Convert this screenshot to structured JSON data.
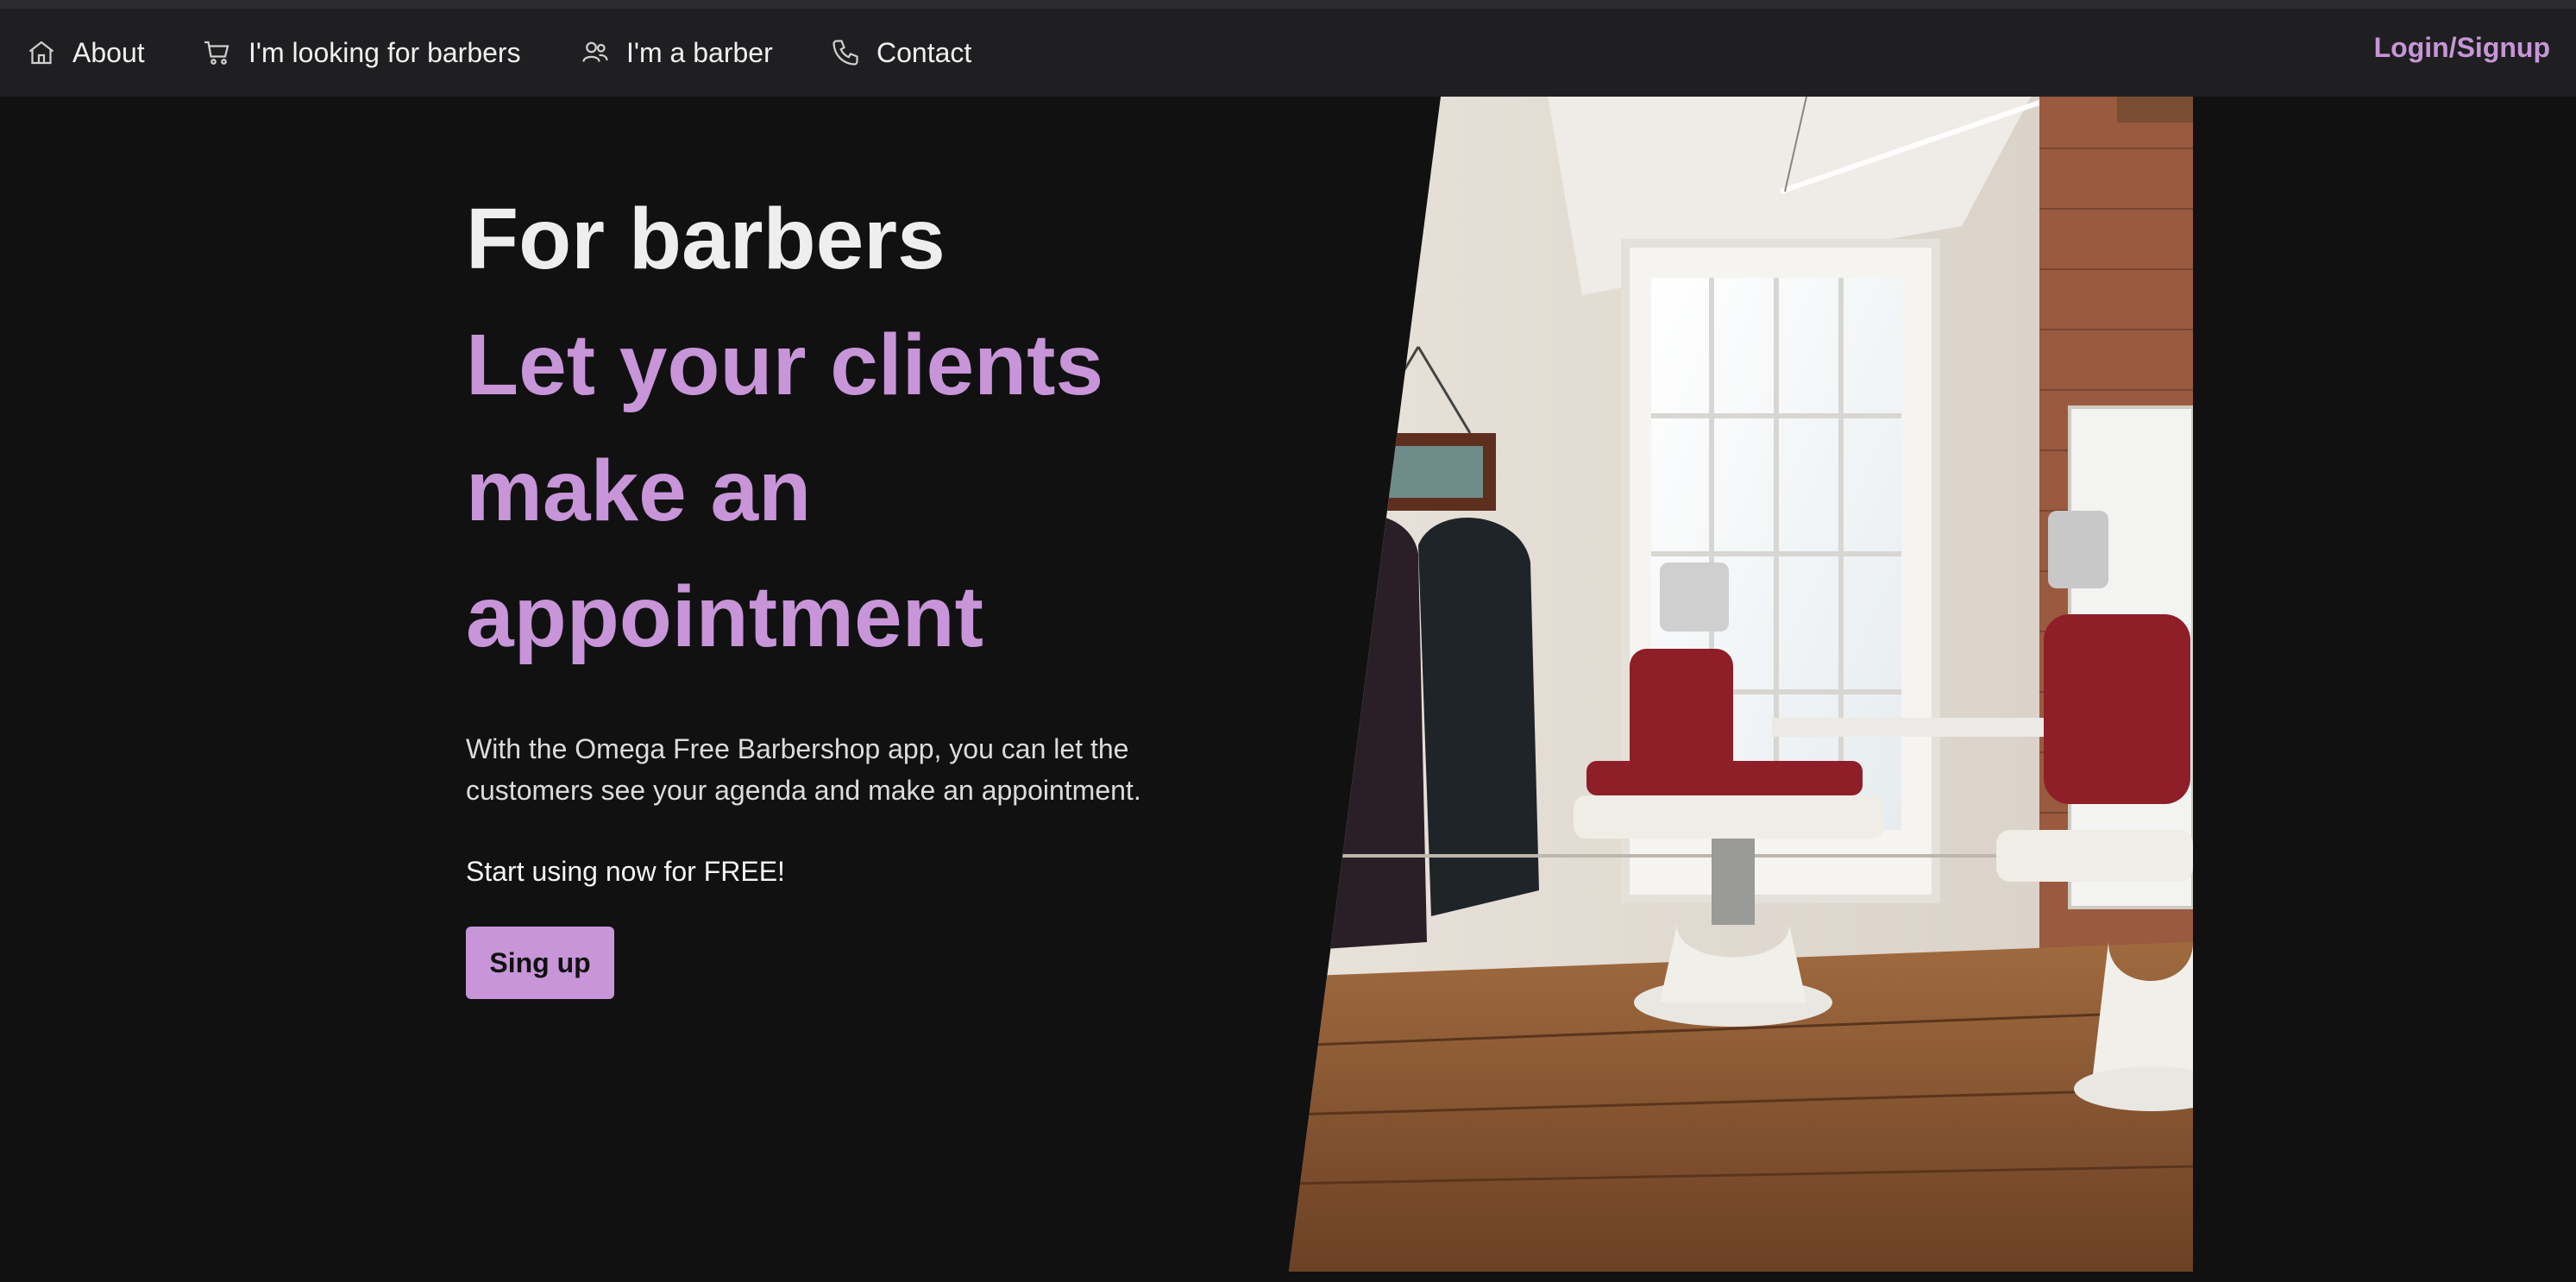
{
  "nav": {
    "about": {
      "label": "About",
      "icon": "home-icon"
    },
    "looking": {
      "label": "I'm looking for barbers",
      "icon": "cart-icon"
    },
    "barber": {
      "label": "I'm a barber",
      "icon": "users-icon"
    },
    "contact": {
      "label": "Contact",
      "icon": "phone-icon"
    },
    "login": "Login/Signup"
  },
  "hero": {
    "title": "For barbers",
    "headline": "Let your clients make an appointment",
    "description": "With the Omega Free Barbershop app, you can let the customers see your agenda and make an appointment.",
    "cta_text": "Start using now for FREE!",
    "button_label": "Sing up"
  },
  "colors": {
    "accent": "#c795d8",
    "background": "#111112",
    "navbar": "#1f1f21"
  }
}
